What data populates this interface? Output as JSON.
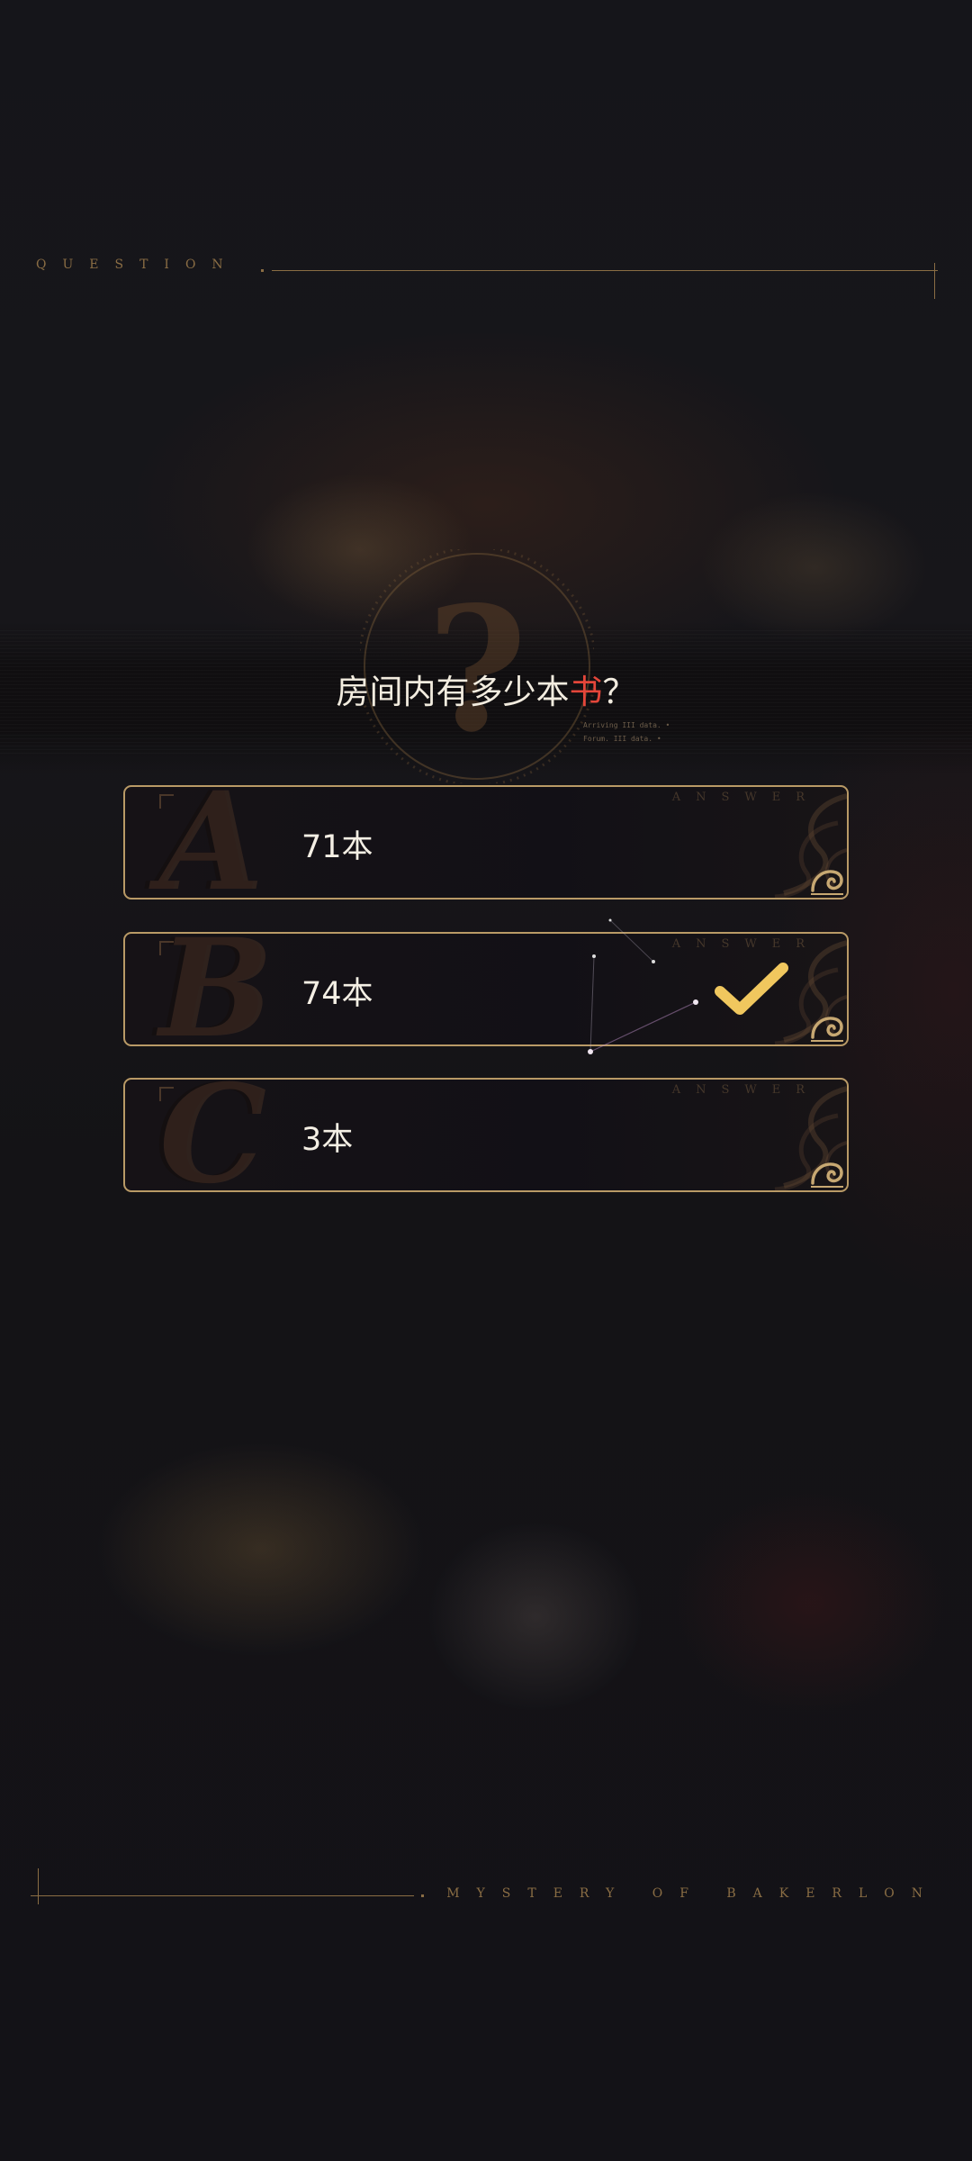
{
  "header": {
    "label": "QUESTION"
  },
  "question": {
    "text_before": "房间内有多少本",
    "highlight": "书",
    "text_after": "？",
    "emblem_glyph": "?",
    "emblem_note_lines": [
      "Arriving  III data. •",
      "Forum.    III data. •"
    ]
  },
  "options": [
    {
      "letter": "A",
      "label": "71本",
      "corner_text": "ANSWER",
      "selected": false
    },
    {
      "letter": "B",
      "label": "74本",
      "corner_text": "ANSWER",
      "selected": true
    },
    {
      "letter": "C",
      "label": "3本",
      "corner_text": "ANSWER",
      "selected": false
    }
  ],
  "footer": {
    "label": "MYSTERY OF BAKERLON"
  },
  "colors": {
    "gold": "#b99a66",
    "check": "#f0c75e",
    "highlight": "#e4463a",
    "text": "#f4efe4"
  },
  "icons": [
    "question-mark-emblem-icon",
    "check-icon",
    "scroll-ornament-icon",
    "constellation-decoration"
  ]
}
